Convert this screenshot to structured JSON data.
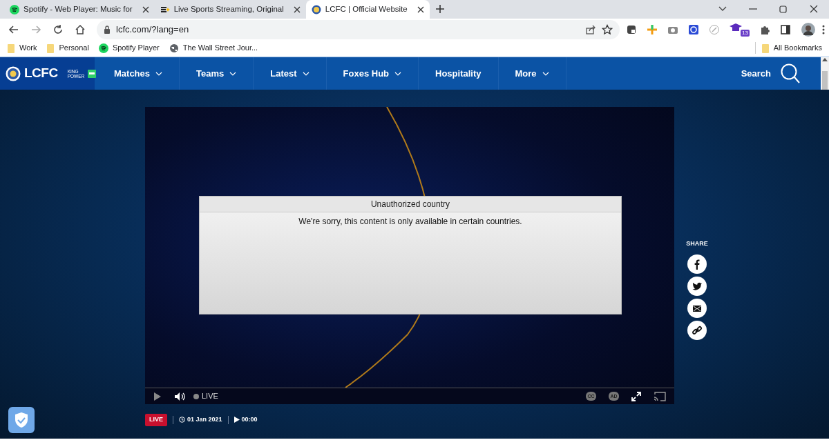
{
  "browser": {
    "tabs": [
      {
        "title": "Spotify - Web Player: Music for",
        "selected": false
      },
      {
        "title": "Live Sports Streaming, Original",
        "selected": false
      },
      {
        "title": "LCFC | Official Website",
        "selected": true
      }
    ],
    "address": "lcfc.com/?lang=en",
    "bookmarks": [
      {
        "label": "Work",
        "kind": "folder"
      },
      {
        "label": "Personal",
        "kind": "folder"
      },
      {
        "label": "Spotify Player",
        "kind": "spotify"
      },
      {
        "label": "The Wall Street Jour...",
        "kind": "globe"
      }
    ],
    "all_bookmarks": "All Bookmarks",
    "extension_badge": "13"
  },
  "site": {
    "logo": "LCFC",
    "sponsor_top": "KING",
    "sponsor_bottom": "POWER",
    "nav": [
      {
        "label": "Matches",
        "dropdown": true
      },
      {
        "label": "Teams",
        "dropdown": true
      },
      {
        "label": "Latest",
        "dropdown": true
      },
      {
        "label": "Foxes Hub",
        "dropdown": true
      },
      {
        "label": "Hospitality",
        "dropdown": false
      },
      {
        "label": "More",
        "dropdown": true
      }
    ],
    "search": "Search"
  },
  "player": {
    "dialog_title": "Unauthorized country",
    "dialog_message": "We're sorry, this content is only available in certain countries.",
    "live": "LIVE",
    "captions": "CC",
    "audio_description": "AD"
  },
  "meta": {
    "badge": "LIVE",
    "date": "01 Jan 2021",
    "duration": "00:00"
  },
  "share": {
    "label": "SHARE",
    "buttons": [
      {
        "kind": "facebook"
      },
      {
        "kind": "twitter"
      },
      {
        "kind": "email"
      },
      {
        "kind": "link"
      }
    ]
  }
}
